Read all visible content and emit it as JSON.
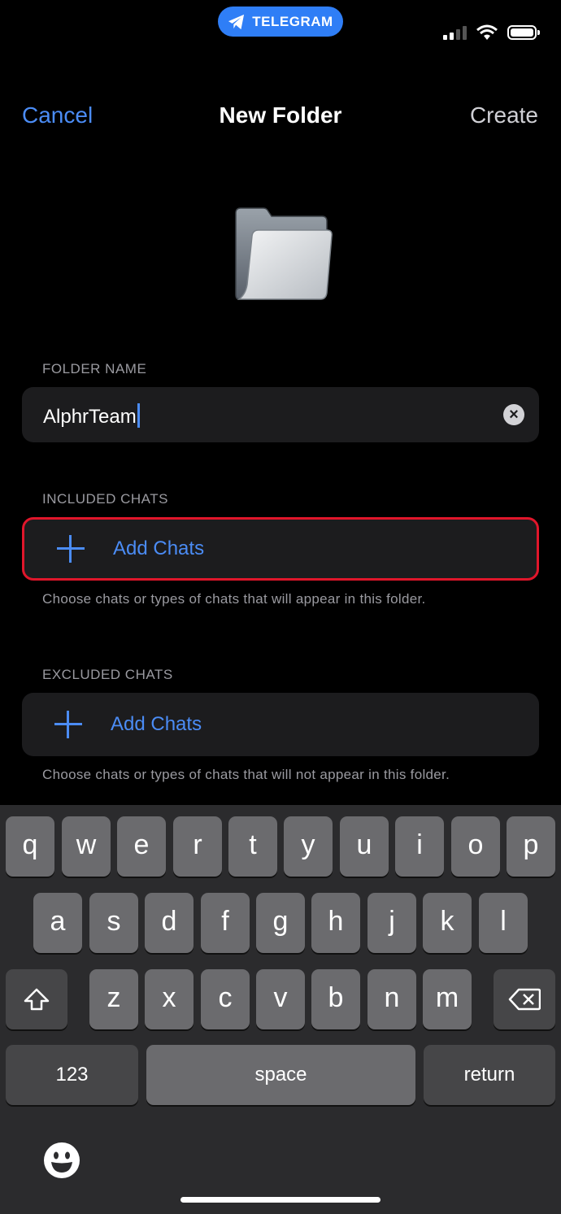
{
  "status_bar": {
    "app_pill": "TELEGRAM"
  },
  "nav": {
    "cancel": "Cancel",
    "title": "New Folder",
    "create": "Create"
  },
  "folder_name": {
    "header": "FOLDER NAME",
    "value": "AlphrTeam",
    "clear_icon": "clear-icon"
  },
  "included": {
    "header": "INCLUDED CHATS",
    "add_label": "Add Chats",
    "note": "Choose chats or types of chats that will appear in this folder."
  },
  "excluded": {
    "header": "EXCLUDED CHATS",
    "add_label": "Add Chats",
    "note": "Choose chats or types of chats that will not appear in this folder."
  },
  "keyboard": {
    "row1": [
      "q",
      "w",
      "e",
      "r",
      "t",
      "y",
      "u",
      "i",
      "o",
      "p"
    ],
    "row2": [
      "a",
      "s",
      "d",
      "f",
      "g",
      "h",
      "j",
      "k",
      "l"
    ],
    "row3": [
      "z",
      "x",
      "c",
      "v",
      "b",
      "n",
      "m"
    ],
    "numbers": "123",
    "space": "space",
    "return": "return"
  },
  "colors": {
    "accent": "#4b8cf5",
    "highlight": "#e0162b",
    "telegram_pill": "#2f7ef6"
  }
}
